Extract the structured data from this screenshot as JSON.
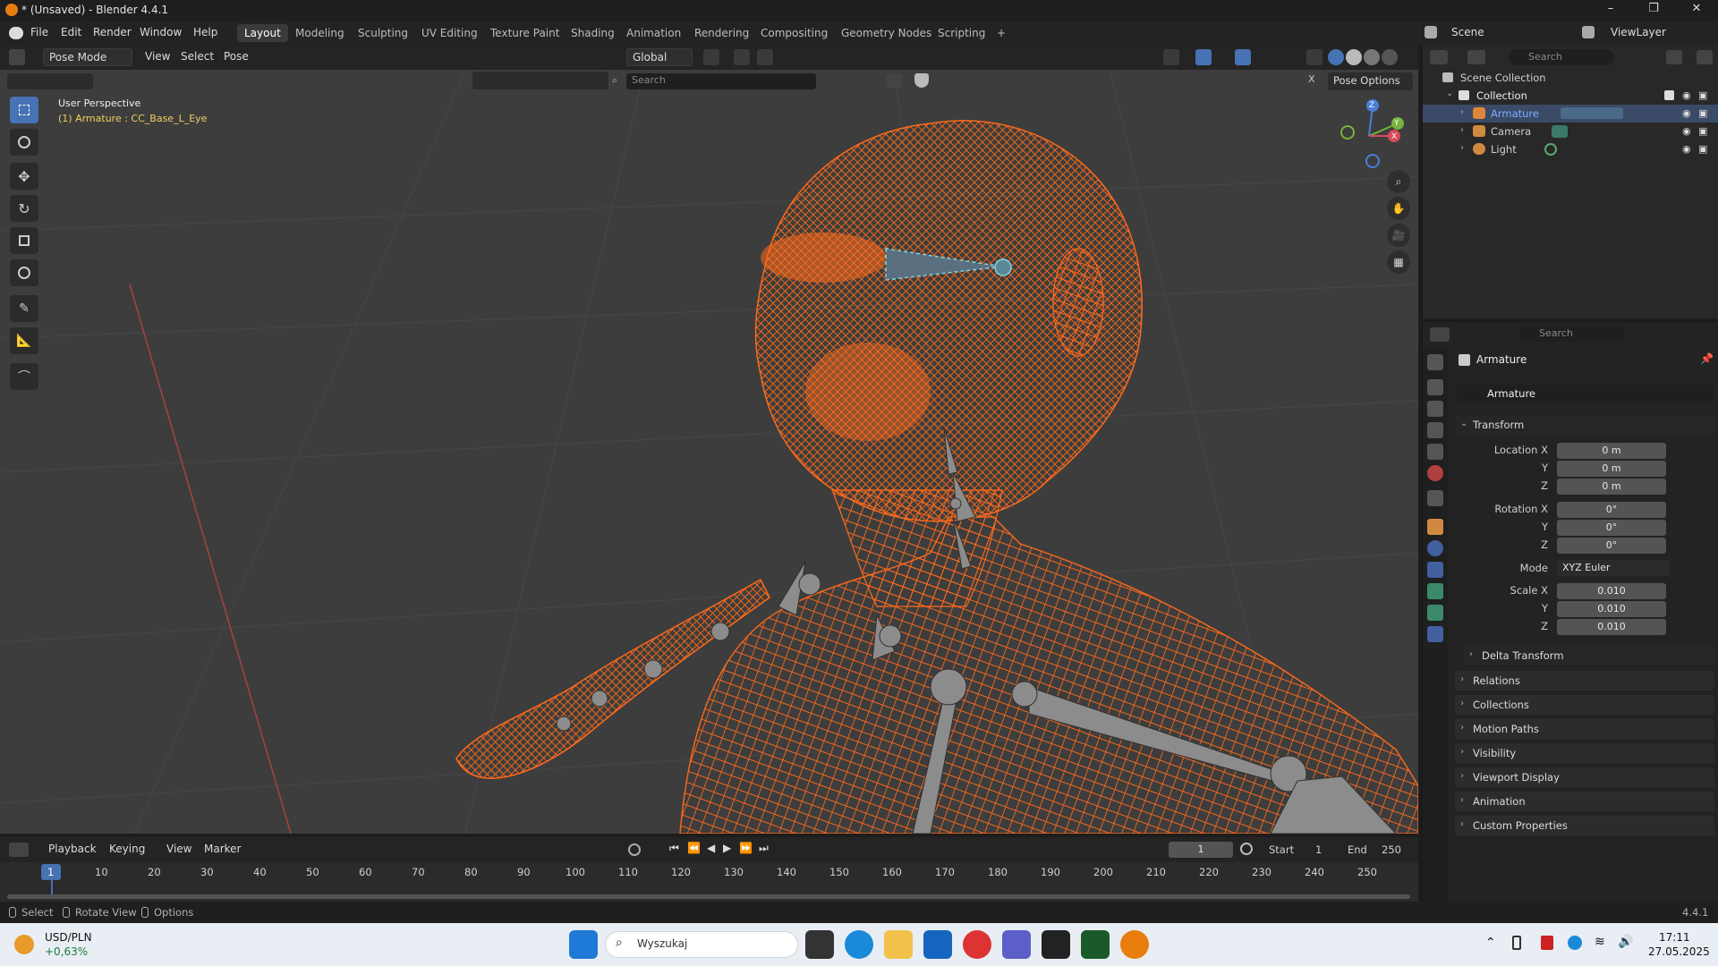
{
  "window": {
    "title": "* (Unsaved) - Blender 4.4.1",
    "minimize": "–",
    "maximize": "❐",
    "close": "✕"
  },
  "menu": {
    "file": "File",
    "edit": "Edit",
    "render": "Render",
    "window": "Window",
    "help": "Help"
  },
  "workspaces": [
    "Layout",
    "Modeling",
    "Sculpting",
    "UV Editing",
    "Texture Paint",
    "Shading",
    "Animation",
    "Rendering",
    "Compositing",
    "Geometry Nodes",
    "Scripting"
  ],
  "workspace_add": "+",
  "scene": {
    "label": "Scene",
    "view_layer": "ViewLayer"
  },
  "viewport_header": {
    "mode": "Pose Mode",
    "view": "View",
    "select": "Select",
    "pose": "Pose",
    "orientation": "Global",
    "search_placeholder": "Search",
    "pose_options": "Pose Options",
    "close_x": "X"
  },
  "viewport": {
    "perspective": "User Perspective",
    "active_object": "(1) Armature : CC_Base_L_Eye",
    "gizmo": {
      "z": "Z",
      "y": "Y",
      "x": "X"
    }
  },
  "outliner": {
    "search_placeholder": "Search",
    "scene_collection": "Scene Collection",
    "collection": "Collection",
    "items": [
      {
        "name": "Armature",
        "selected": true
      },
      {
        "name": "Camera",
        "selected": false
      },
      {
        "name": "Light",
        "selected": false
      }
    ]
  },
  "properties": {
    "search_placeholder": "Search",
    "object_name": "Armature",
    "data_name": "Armature",
    "transform": {
      "title": "Transform",
      "location_label": "Location X",
      "y": "Y",
      "z": "Z",
      "location": [
        "0 m",
        "0 m",
        "0 m"
      ],
      "rotation_label": "Rotation X",
      "rotation": [
        "0°",
        "0°",
        "0°"
      ],
      "mode_label": "Mode",
      "mode_value": "XYZ Euler",
      "scale_label": "Scale X",
      "scale": [
        "0.010",
        "0.010",
        "0.010"
      ]
    },
    "delta_transform": "Delta Transform",
    "panels": [
      "Relations",
      "Collections",
      "Motion Paths",
      "Visibility",
      "Viewport Display",
      "Animation",
      "Custom Properties"
    ]
  },
  "timeline": {
    "playback": "Playback",
    "keying": "Keying",
    "view": "View",
    "marker": "Marker",
    "current_frame": "1",
    "start_label": "Start",
    "start": "1",
    "end_label": "End",
    "end": "250",
    "ticks": [
      "1",
      "10",
      "20",
      "30",
      "40",
      "50",
      "60",
      "70",
      "80",
      "90",
      "100",
      "110",
      "120",
      "130",
      "140",
      "150",
      "160",
      "170",
      "180",
      "190",
      "200",
      "210",
      "220",
      "230",
      "240",
      "250"
    ]
  },
  "statusbar": {
    "select": "Select",
    "rotate_view": "Rotate View",
    "options": "Options",
    "version": "4.4.1"
  },
  "taskbar": {
    "ticker": "USD/PLN",
    "change": "+0,63%",
    "search_placeholder": "Wyszukaj",
    "time": "17:11",
    "date": "27.05.2025"
  },
  "colors": {
    "accent": "#4772b3",
    "wire": "#ff6a1a",
    "selected_bone": "#7fd6e0",
    "axis_red": "#b03a3a"
  }
}
